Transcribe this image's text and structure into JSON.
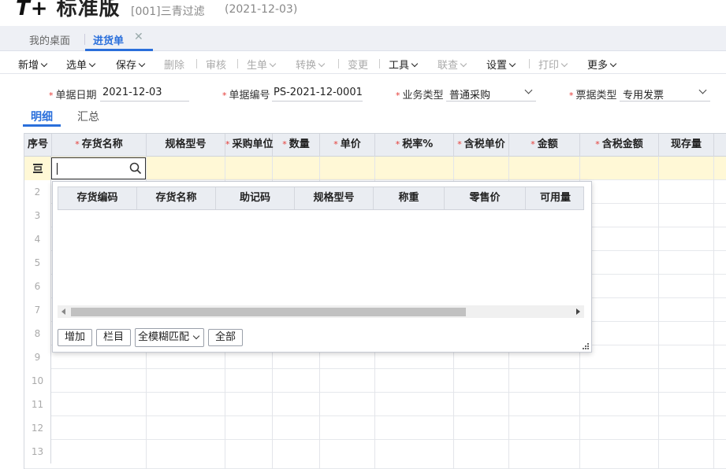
{
  "app": {
    "logo_mark": "T+",
    "logo_text": "标准版",
    "account": "[001]三青过滤",
    "date": "(2021-12-03)"
  },
  "tabs": {
    "home": "我的桌面",
    "active": "进货单",
    "close": "✕"
  },
  "toolbar": {
    "add": "新增",
    "select": "选单",
    "save": "保存",
    "delete": "删除",
    "audit": "审核",
    "generate": "生单",
    "convert": "转换",
    "change": "变更",
    "tools": "工具",
    "query": "联查",
    "settings": "设置",
    "print": "打印",
    "more": "更多"
  },
  "form": {
    "date_label": "单据日期",
    "date_value": "2021-12-03",
    "code_label": "单据编号",
    "code_value": "PS-2021-12-0001",
    "biz_type_label": "业务类型",
    "biz_type_value": "普通采购",
    "invoice_type_label": "票据类型",
    "invoice_type_value": "专用发票"
  },
  "subtabs": {
    "detail": "明细",
    "summary": "汇总"
  },
  "grid": {
    "headers": {
      "seq": "序号",
      "item_name": "存货名称",
      "spec": "规格型号",
      "unit": "采购单位",
      "qty": "数量",
      "price": "单价",
      "tax_rate": "税率%",
      "tax_price": "含税单价",
      "amount": "金额",
      "tax_amount": "含税金额",
      "stock": "现存量"
    },
    "row_numbers": [
      "2",
      "3",
      "4",
      "5",
      "6",
      "7",
      "8",
      "9",
      "10",
      "11",
      "12",
      "13"
    ]
  },
  "popup": {
    "headers": {
      "code": "存货编码",
      "name": "存货名称",
      "mnemonic": "助记码",
      "spec": "规格型号",
      "weight": "称重",
      "retail_price": "零售价",
      "available": "可用量"
    },
    "add_button": "增加",
    "columns_button": "栏目",
    "match_mode": "全模糊匹配",
    "all_button": "全部"
  },
  "colors": {
    "accent": "#2a6fdb",
    "required": "#e53935",
    "active_row": "#fff8d6",
    "header_bg": "#eaedf2"
  }
}
